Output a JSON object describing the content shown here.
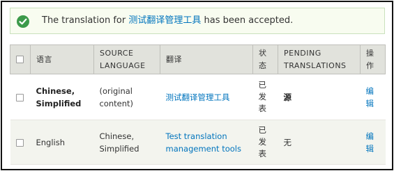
{
  "message": {
    "prefix": "The translation for ",
    "link": "测试翻译管理工具",
    "suffix": " has been accepted."
  },
  "table": {
    "headers": {
      "language": "语言",
      "source_language": "SOURCE LANGUAGE",
      "translation": "翻译",
      "status": "状态",
      "pending": "PENDING TRANSLATIONS",
      "operations": "操作"
    },
    "rows": [
      {
        "language": "Chinese, Simplified",
        "source_language": "(original content)",
        "translation": "测试翻译管理工具",
        "status": "已发表",
        "pending": "源",
        "operation": "编辑"
      },
      {
        "language": "English",
        "source_language": "Chinese, Simplified",
        "translation": "Test translation management tools",
        "status": "已发表",
        "pending": "无",
        "operation": "编辑"
      }
    ]
  },
  "colors": {
    "link": "#0074bd",
    "success_icon": "#3c9a4a",
    "header_bg": "#e1e2dc"
  },
  "icons": {
    "status": "check-icon"
  }
}
